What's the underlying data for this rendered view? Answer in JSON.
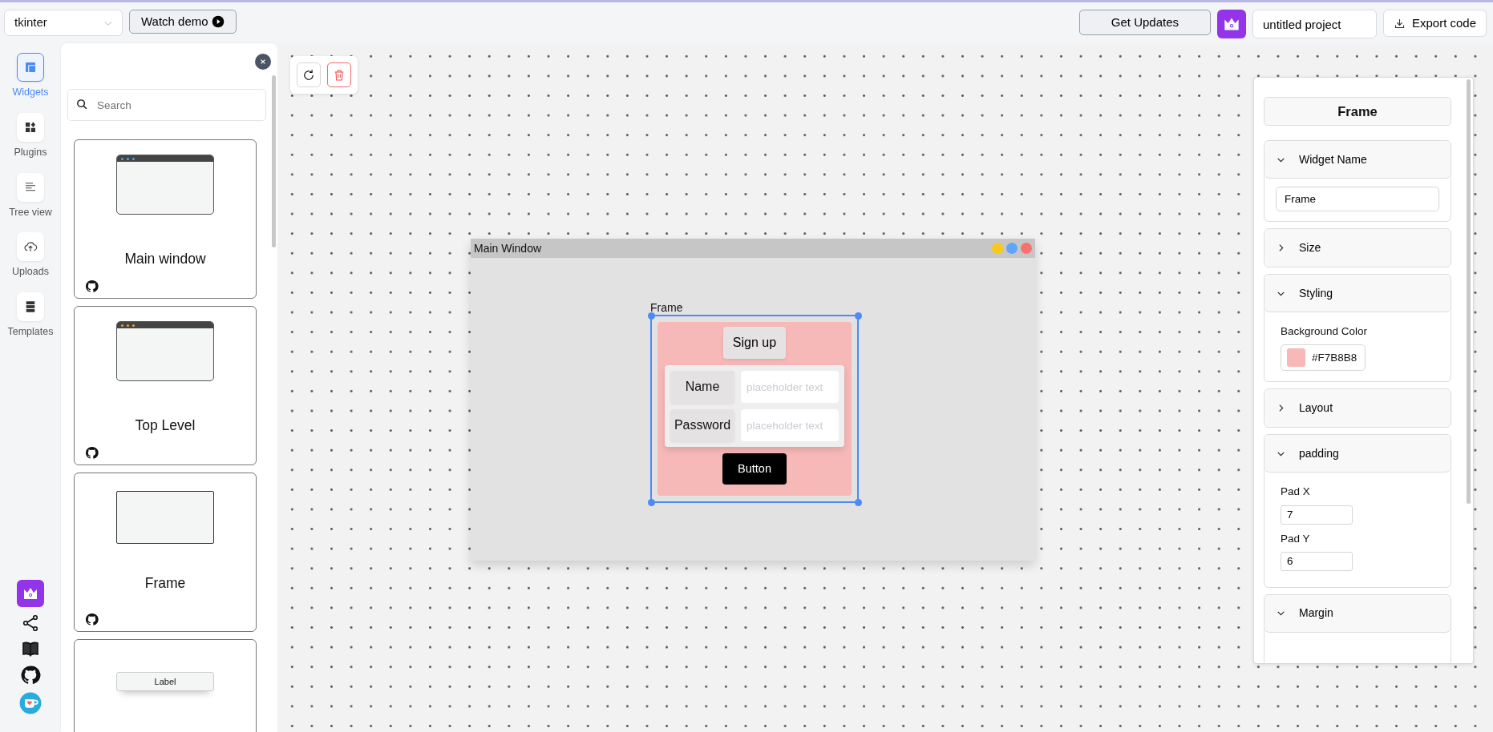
{
  "topbar": {
    "framework": "tkinter",
    "watch_demo": "Watch demo",
    "get_updates": "Get Updates",
    "project_name": "untitled project",
    "export": "Export code"
  },
  "rail": {
    "items": [
      {
        "kind": "widgets",
        "label": "Widgets",
        "selected": true
      },
      {
        "kind": "plugins",
        "label": "Plugins",
        "selected": false
      },
      {
        "kind": "tree",
        "label": "Tree view",
        "selected": false
      },
      {
        "kind": "uploads",
        "label": "Uploads",
        "selected": false
      },
      {
        "kind": "templates",
        "label": "Templates",
        "selected": false
      }
    ]
  },
  "widget_panel": {
    "search": {
      "placeholder": "Search"
    },
    "cards": [
      {
        "kind": "main_window",
        "label": "Main window"
      },
      {
        "kind": "toplevel",
        "label": "Top Level"
      },
      {
        "kind": "frame",
        "label": "Frame"
      },
      {
        "kind": "label",
        "preview_text": "Label"
      }
    ]
  },
  "canvas": {
    "window": {
      "title": "Main Window",
      "frame": {
        "caption": "Frame",
        "selected": true,
        "color": "#f7b8b8",
        "heading": "Sign up",
        "rows": [
          {
            "label": "Name",
            "placeholder": "placeholder text"
          },
          {
            "label": "Password",
            "placeholder": "placeholder text"
          }
        ],
        "button": "Button"
      }
    }
  },
  "properties": {
    "title": "Frame",
    "sections": [
      {
        "title": "Widget Name",
        "expanded": true,
        "fields": [
          {
            "kind": "text",
            "value": "Frame"
          }
        ]
      },
      {
        "title": "Size",
        "expanded": false
      },
      {
        "title": "Styling",
        "expanded": true,
        "fields": [
          {
            "kind": "color",
            "label": "Background Color",
            "value": "#F7B8B8",
            "color": "#f7b8b8"
          }
        ]
      },
      {
        "title": "Layout",
        "expanded": false
      },
      {
        "title": "padding",
        "expanded": true,
        "fields": [
          {
            "kind": "number",
            "label": "Pad X",
            "value": "7"
          },
          {
            "kind": "number",
            "label": "Pad Y",
            "value": "6"
          }
        ]
      },
      {
        "title": "Margin",
        "expanded": true
      }
    ]
  }
}
